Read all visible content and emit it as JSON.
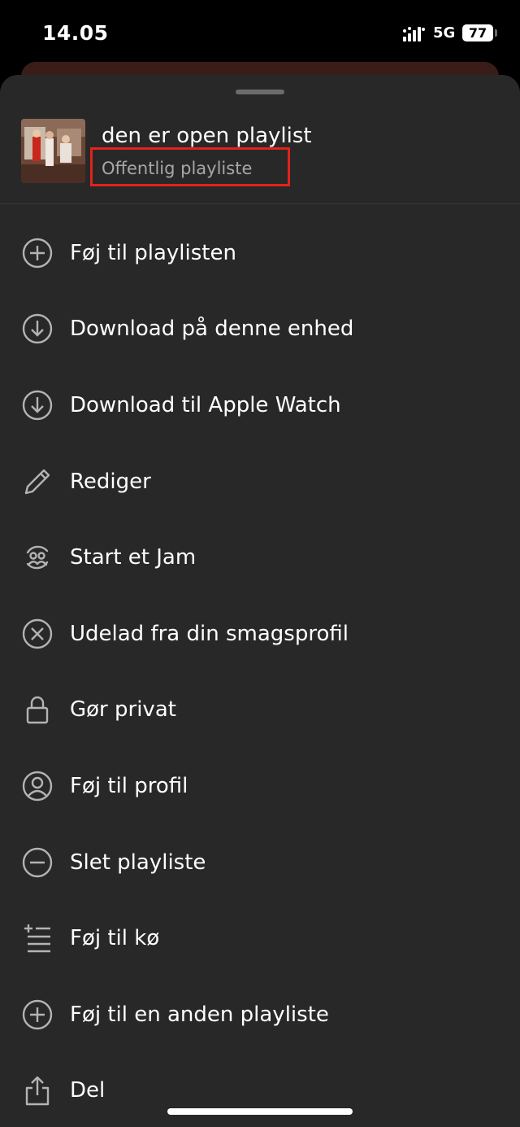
{
  "status_bar": {
    "time": "14.05",
    "network": "5G",
    "battery": "77"
  },
  "sheet": {
    "playlist_title": "den er open playlist",
    "playlist_subtitle": "Offentlig playliste",
    "menu": [
      {
        "label": "Føj til playlisten",
        "icon": "plus-circle-icon"
      },
      {
        "label": "Download på denne enhed",
        "icon": "download-circle-icon"
      },
      {
        "label": "Download til Apple Watch",
        "icon": "download-circle-icon"
      },
      {
        "label": "Rediger",
        "icon": "pencil-icon"
      },
      {
        "label": "Start et Jam",
        "icon": "jam-icon"
      },
      {
        "label": "Udelad fra din smagsprofil",
        "icon": "x-circle-icon"
      },
      {
        "label": "Gør privat",
        "icon": "lock-icon"
      },
      {
        "label": "Føj til profil",
        "icon": "profile-circle-icon"
      },
      {
        "label": "Slet playliste",
        "icon": "minus-circle-icon"
      },
      {
        "label": "Føj til kø",
        "icon": "add-to-queue-icon"
      },
      {
        "label": "Føj til en anden playliste",
        "icon": "plus-circle-icon"
      },
      {
        "label": "Del",
        "icon": "share-icon"
      }
    ]
  },
  "colors": {
    "sheet_bg": "#282828",
    "highlight_box": "#e0231b",
    "subtitle": "#a7a7a7"
  }
}
